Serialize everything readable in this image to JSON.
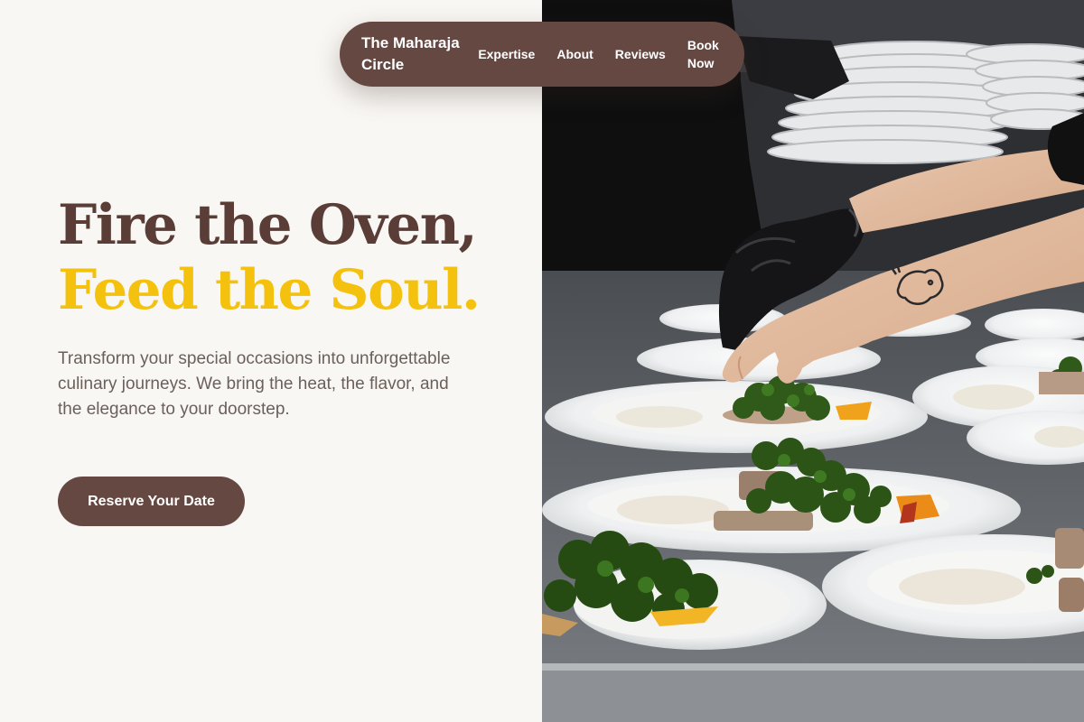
{
  "nav": {
    "brand": "The Maharaja Circle",
    "links": [
      "Expertise",
      "About",
      "Reviews",
      "Book Now"
    ]
  },
  "hero": {
    "headline_line1": "Fire the Oven,",
    "headline_line2": "Feed the Soul.",
    "description": "Transform your special occasions into unforgettable culinary journeys. We bring the heat, the flavor, and the elegance to your doorstep.",
    "cta_label": "Reserve Your Date"
  },
  "colors": {
    "brand_brown": "#654841",
    "headline_brown": "#5a3d36",
    "accent_yellow": "#f4c10f",
    "background": "#f9f7f4"
  }
}
